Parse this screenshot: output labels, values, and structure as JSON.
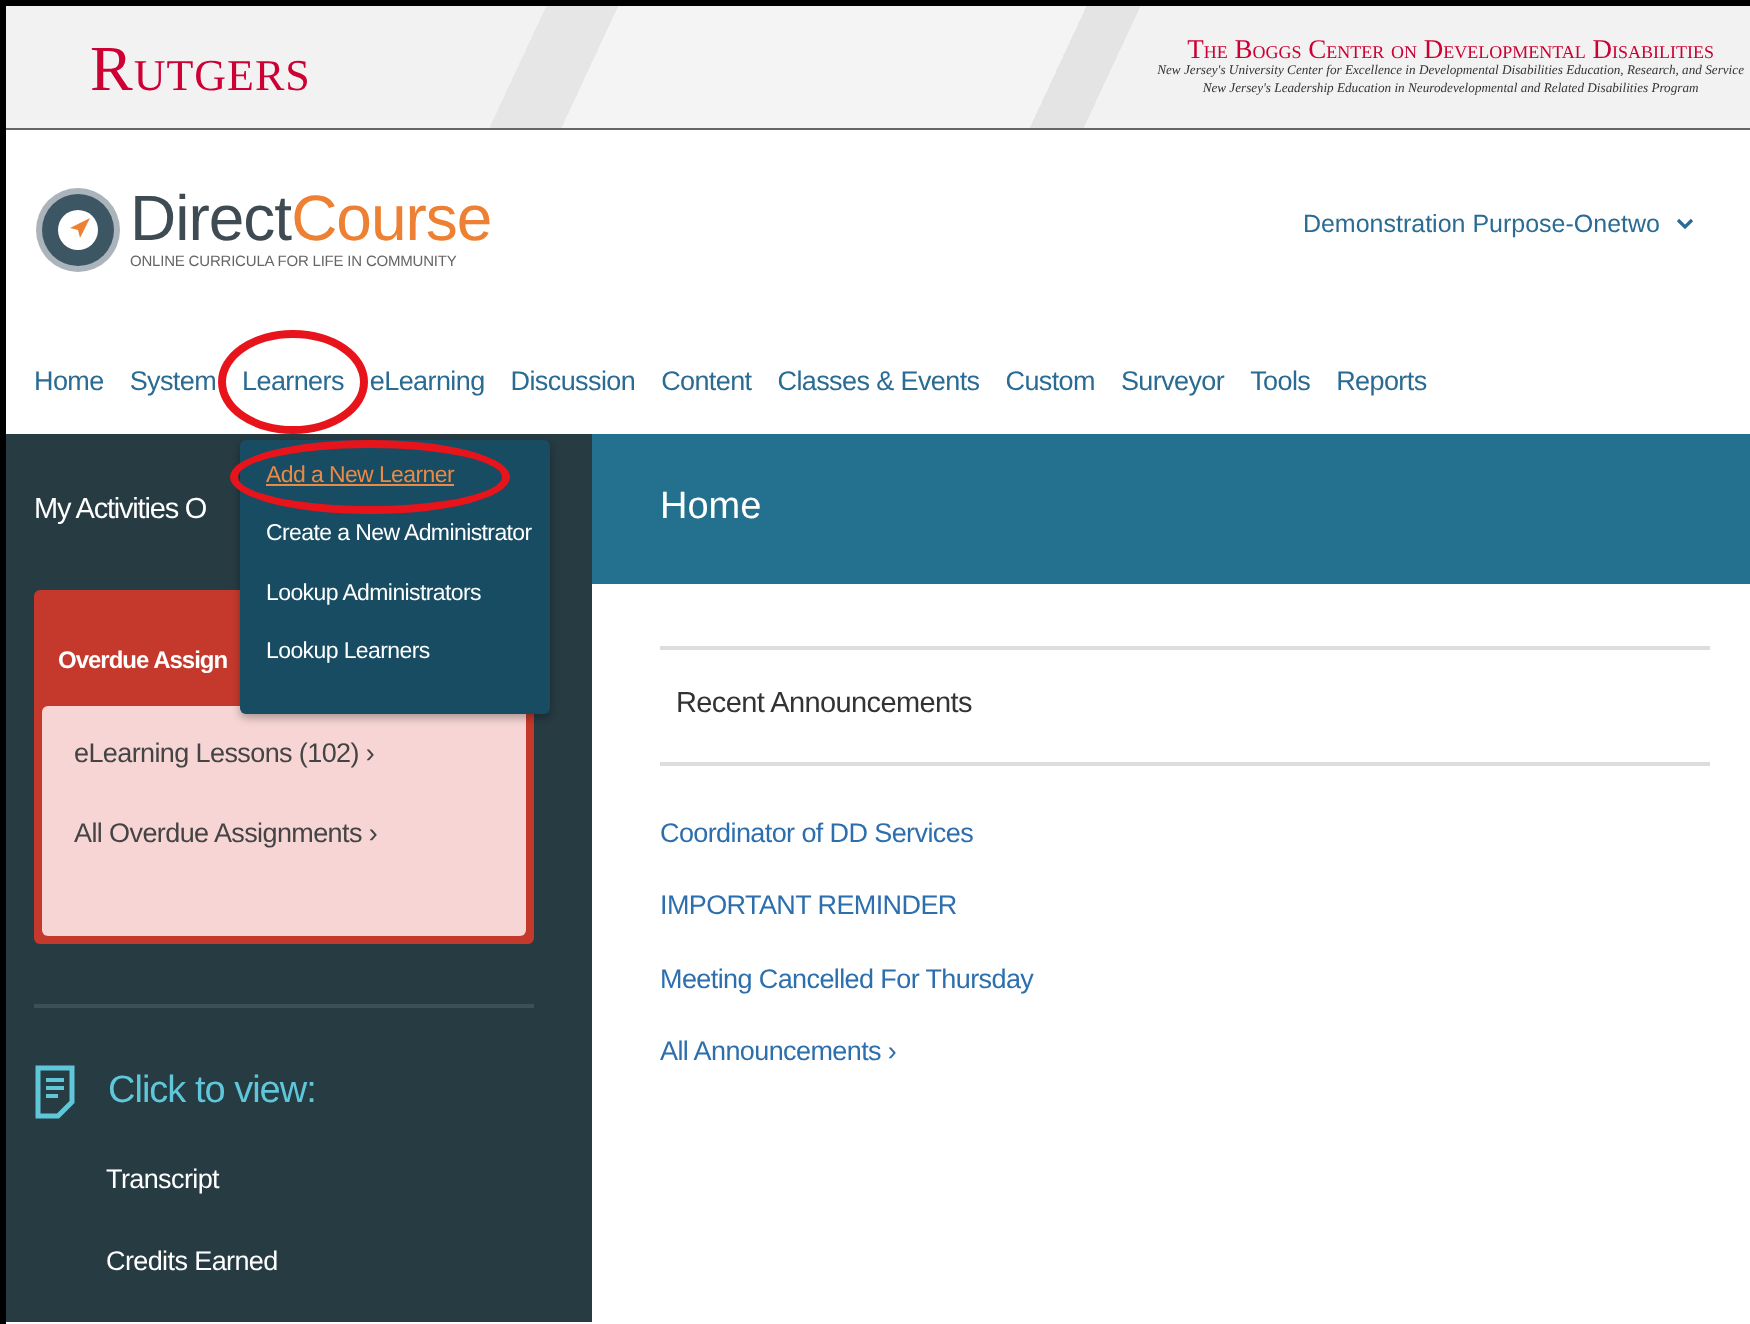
{
  "banner": {
    "university": "Rutgers",
    "center": "The Boggs Center on Developmental Disabilities",
    "tagline_1": "New Jersey's University Center for Excellence in Developmental Disabilities Education, Research, and Service",
    "tagline_2": "New Jersey's Leadership Education in Neurodevelopmental and Related Disabilities Program"
  },
  "logo": {
    "name_main": "Direct",
    "name_accent": "Course",
    "subtitle": "ONLINE CURRICULA FOR LIFE IN COMMUNITY"
  },
  "account": {
    "label": "Demonstration Purpose-Onetwo"
  },
  "nav": [
    {
      "label": "Home",
      "circled": false
    },
    {
      "label": "System",
      "circled": false
    },
    {
      "label": "Learners",
      "circled": true
    },
    {
      "label": "eLearning",
      "circled": false
    },
    {
      "label": "Discussion",
      "circled": false
    },
    {
      "label": "Content",
      "circled": false
    },
    {
      "label": "Classes & Events",
      "circled": false
    },
    {
      "label": "Custom",
      "circled": false
    },
    {
      "label": "Surveyor",
      "circled": false
    },
    {
      "label": "Tools",
      "circled": false
    },
    {
      "label": "Reports",
      "circled": false
    }
  ],
  "dropdown": [
    {
      "label": "Add a New Learner",
      "selected": true,
      "circled": true
    },
    {
      "label": "Create a New Administrator",
      "selected": false,
      "circled": false
    },
    {
      "label": "Lookup Administrators",
      "selected": false,
      "circled": false
    },
    {
      "label": "Lookup Learners",
      "selected": false,
      "circled": false
    }
  ],
  "sidebar": {
    "title": "My Activities O",
    "overdue": {
      "title": "Overdue Assign",
      "links": [
        "eLearning Lessons (102) ›",
        "All Overdue Assignments ›"
      ]
    },
    "view_heading": "Click to view:",
    "view_links": [
      "Transcript",
      "Credits Earned"
    ]
  },
  "main": {
    "title": "Home",
    "section": "Recent Announcements",
    "announcements": [
      "Coordinator of DD Services",
      "IMPORTANT REMINDER",
      "Meeting Cancelled For Thursday",
      "All Announcements ›"
    ]
  }
}
